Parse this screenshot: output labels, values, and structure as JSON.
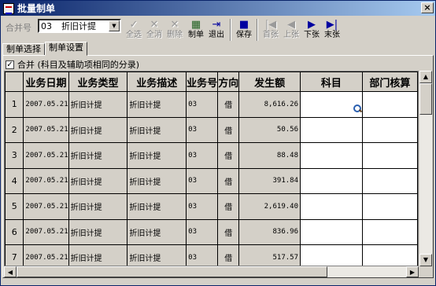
{
  "window": {
    "title": "批量制单",
    "close_glyph": "×"
  },
  "toolbar": {
    "merge_label": "合并号",
    "merge_code": "03",
    "merge_name": "折旧计提",
    "buttons": [
      {
        "label": "全选",
        "icon": "select-all-icon",
        "glyph": "✓",
        "enabled": false
      },
      {
        "label": "全消",
        "icon": "deselect-all-icon",
        "glyph": "✕",
        "enabled": false
      },
      {
        "label": "删除",
        "icon": "delete-icon",
        "glyph": "✕",
        "enabled": false
      },
      {
        "label": "制单",
        "icon": "make-voucher-icon",
        "glyph": "▦",
        "enabled": true
      },
      {
        "label": "退出",
        "icon": "exit-icon",
        "glyph": "⇥",
        "enabled": true
      },
      {
        "label": "保存",
        "icon": "save-icon",
        "glyph": "■",
        "enabled": true
      },
      {
        "label": "首张",
        "icon": "first-page-icon",
        "glyph": "|◀",
        "enabled": false
      },
      {
        "label": "上张",
        "icon": "prev-page-icon",
        "glyph": "◀",
        "enabled": false
      },
      {
        "label": "下张",
        "icon": "next-page-icon",
        "glyph": "▶",
        "enabled": true
      },
      {
        "label": "末张",
        "icon": "last-page-icon",
        "glyph": "▶|",
        "enabled": true
      }
    ]
  },
  "tabs": [
    {
      "label": "制单选择"
    },
    {
      "label": "制单设置",
      "active": true
    }
  ],
  "merge_checkbox": {
    "checked": true,
    "check_glyph": "✓",
    "label": "合并 (科目及辅助项相同的分录)"
  },
  "grid": {
    "columns": [
      "业务日期",
      "业务类型",
      "业务描述",
      "业务号",
      "方向",
      "发生额",
      "科目",
      "部门核算"
    ],
    "rows": [
      {
        "num": "1",
        "date": "2007.05.21",
        "type": "折旧计提",
        "desc": "折旧计提",
        "no": "03",
        "dir": "借",
        "amount": "8,616.26",
        "subject": "",
        "dept": ""
      },
      {
        "num": "2",
        "date": "2007.05.21",
        "type": "折旧计提",
        "desc": "折旧计提",
        "no": "03",
        "dir": "借",
        "amount": "50.56",
        "subject": "",
        "dept": ""
      },
      {
        "num": "3",
        "date": "2007.05.21",
        "type": "折旧计提",
        "desc": "折旧计提",
        "no": "03",
        "dir": "借",
        "amount": "88.48",
        "subject": "",
        "dept": ""
      },
      {
        "num": "4",
        "date": "2007.05.21",
        "type": "折旧计提",
        "desc": "折旧计提",
        "no": "03",
        "dir": "借",
        "amount": "391.84",
        "subject": "",
        "dept": ""
      },
      {
        "num": "5",
        "date": "2007.05.21",
        "type": "折旧计提",
        "desc": "折旧计提",
        "no": "03",
        "dir": "借",
        "amount": "2,619.40",
        "subject": "",
        "dept": ""
      },
      {
        "num": "6",
        "date": "2007.05.21",
        "type": "折旧计提",
        "desc": "折旧计提",
        "no": "03",
        "dir": "借",
        "amount": "836.96",
        "subject": "",
        "dept": ""
      },
      {
        "num": "7",
        "date": "2007.05.21",
        "type": "折旧计提",
        "desc": "折旧计提",
        "no": "03",
        "dir": "借",
        "amount": "517.57",
        "subject": "",
        "dept": ""
      }
    ]
  },
  "scroll": {
    "up": "▲",
    "down": "▼",
    "left": "◀",
    "right": "▶"
  }
}
